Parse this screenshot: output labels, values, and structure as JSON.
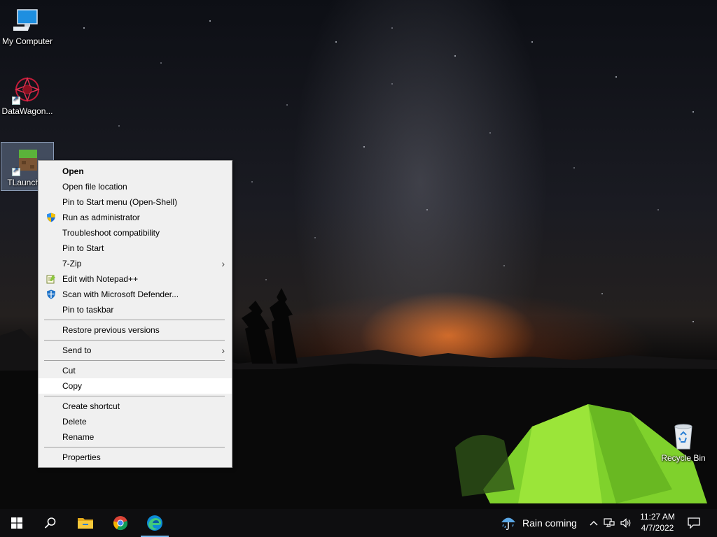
{
  "desktop": {
    "icons": [
      {
        "label": "My Computer",
        "icon": "computer-icon"
      },
      {
        "label": "DataWagon...",
        "icon": "datawagon-icon"
      },
      {
        "label": "TLauncher",
        "icon": "tlauncher-icon"
      },
      {
        "label": "Recycle Bin",
        "icon": "recycle-bin-icon"
      }
    ]
  },
  "context_menu": {
    "items": [
      {
        "label": "Open"
      },
      {
        "label": "Open file location"
      },
      {
        "label": "Pin to Start menu (Open-Shell)"
      },
      {
        "label": "Run as administrator",
        "icon": "uac-shield-icon"
      },
      {
        "label": "Troubleshoot compatibility"
      },
      {
        "label": "Pin to Start"
      },
      {
        "label": "7-Zip",
        "submenu": "›"
      },
      {
        "label": "Edit with Notepad++",
        "icon": "notepadpp-icon"
      },
      {
        "label": "Scan with Microsoft Defender...",
        "icon": "defender-icon"
      },
      {
        "label": "Pin to taskbar"
      },
      {
        "label": "Restore previous versions"
      },
      {
        "label": "Send to",
        "submenu": "›"
      },
      {
        "label": "Cut"
      },
      {
        "label": "Copy"
      },
      {
        "label": "Create shortcut"
      },
      {
        "label": "Delete"
      },
      {
        "label": "Rename"
      },
      {
        "label": "Properties"
      }
    ],
    "highlighted": "Copy"
  },
  "taskbar": {
    "apps": [
      "start-icon",
      "search-icon",
      "file-explorer-icon",
      "chrome-icon",
      "edge-icon"
    ],
    "weather": {
      "text": "Rain coming",
      "icon": "umbrella-icon"
    },
    "tray_icons": [
      "chevron-up-icon",
      "network-icon",
      "volume-icon"
    ],
    "time": "11:27 AM",
    "date": "4/7/2022",
    "notification_icon": "notification-icon"
  },
  "colors": {
    "menu_bg": "#f0f0f0",
    "menu_hover": "#ffffff",
    "taskbar_bg": "#0e0e10",
    "active_indicator": "#76b9ed"
  }
}
